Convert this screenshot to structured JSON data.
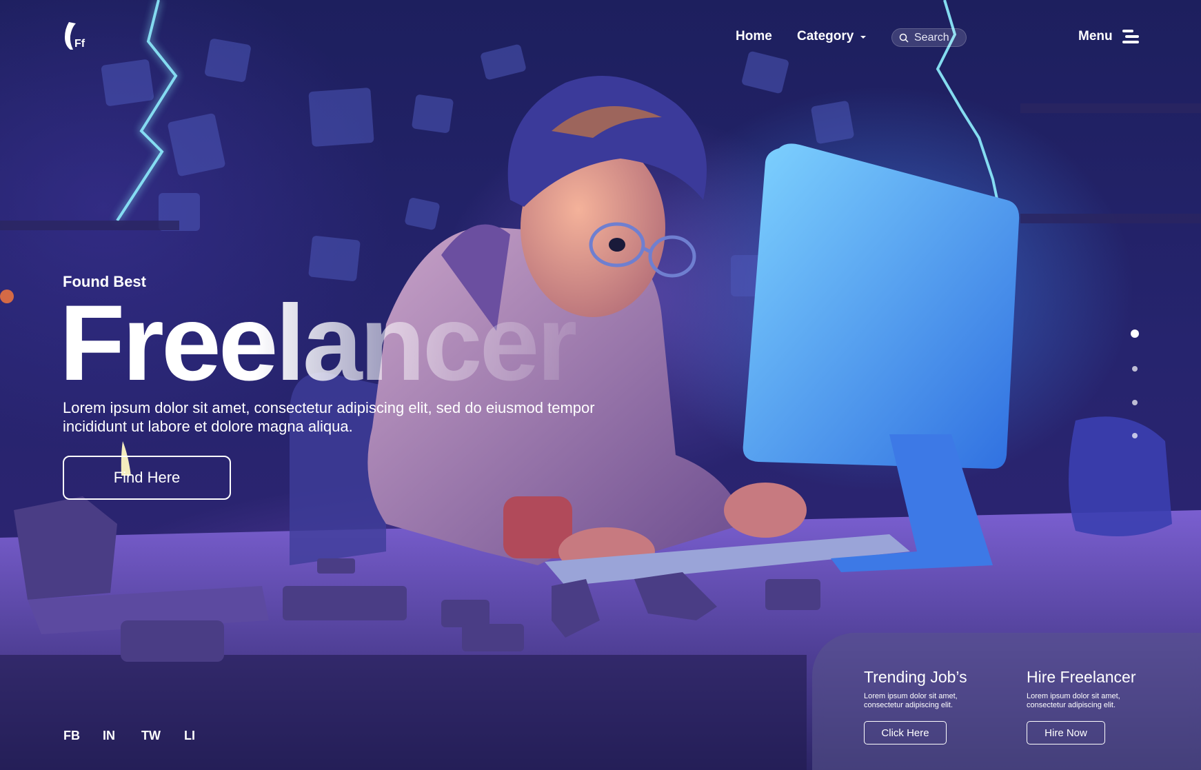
{
  "nav": {
    "logo_text": "Ff",
    "home": "Home",
    "category": "Category",
    "search_placeholder": "Search",
    "menu": "Menu"
  },
  "hero": {
    "eyebrow": "Found Best",
    "headline": "Freelancer",
    "description": "Lorem ipsum dolor sit amet, consectetur adipiscing elit, sed do eiusmod tempor incididunt ut labore et dolore magna aliqua.",
    "cta": "Find Here"
  },
  "social": [
    "FB",
    "IN",
    "TW",
    "LI"
  ],
  "cards": [
    {
      "title": "Trending Job’s",
      "text": "Lorem ipsum dolor sit amet, consectetur adipiscing elit.",
      "button": "Click Here"
    },
    {
      "title": "Hire Freelancer",
      "text": "Lorem ipsum dolor sit amet, consectetur adipiscing elit.",
      "button": "Hire Now"
    }
  ],
  "pager": {
    "total": 4,
    "active": 1
  },
  "colors": {
    "background": "#1b1a52",
    "glow_blue": "#4aa0ff",
    "glow_purple": "#8c5adc",
    "card": "#5a558c"
  }
}
